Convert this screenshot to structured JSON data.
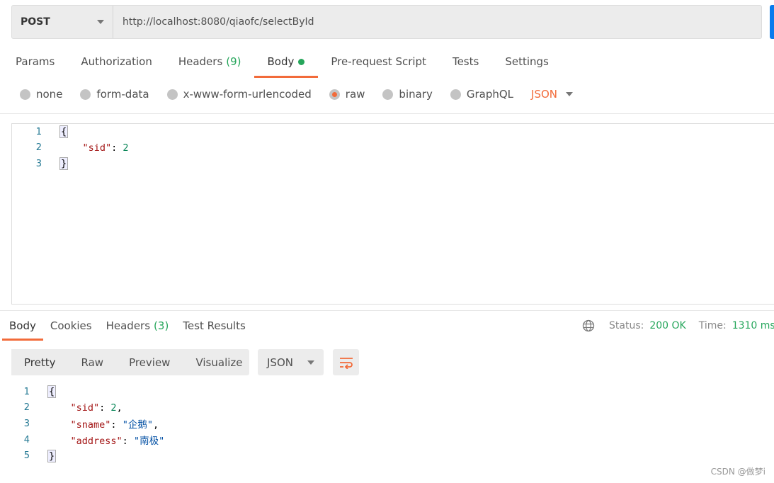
{
  "request": {
    "method": "POST",
    "url": "http://localhost:8080/qiaofc/selectById"
  },
  "tabs": [
    {
      "label": "Params"
    },
    {
      "label": "Authorization"
    },
    {
      "label": "Headers",
      "count": "(9)"
    },
    {
      "label": "Body",
      "active": true
    },
    {
      "label": "Pre-request Script"
    },
    {
      "label": "Tests"
    },
    {
      "label": "Settings"
    }
  ],
  "body_types": [
    {
      "label": "none"
    },
    {
      "label": "form-data"
    },
    {
      "label": "x-www-form-urlencoded"
    },
    {
      "label": "raw",
      "selected": true
    },
    {
      "label": "binary"
    },
    {
      "label": "GraphQL"
    }
  ],
  "body_format": "JSON",
  "request_body": [
    [
      "1",
      "{"
    ],
    [
      "2",
      "    \"sid\": 2"
    ],
    [
      "3",
      "}"
    ]
  ],
  "response": {
    "tabs": [
      {
        "label": "Body",
        "active": true
      },
      {
        "label": "Cookies"
      },
      {
        "label": "Headers",
        "count": "(3)"
      },
      {
        "label": "Test Results"
      }
    ],
    "status_label": "Status:",
    "status": "200 OK",
    "time_label": "Time:",
    "time": "1310 ms",
    "view_modes": [
      "Pretty",
      "Raw",
      "Preview",
      "Visualize"
    ],
    "active_view": "Pretty",
    "format": "JSON",
    "lines": [
      [
        "1",
        "{"
      ],
      [
        "2",
        "    \"sid\": 2,"
      ],
      [
        "3",
        "    \"sname\": \"企鹅\","
      ],
      [
        "4",
        "    \"address\": \"南极\""
      ],
      [
        "5",
        "}"
      ]
    ]
  },
  "watermark": "CSDN @做梦i",
  "colors": {
    "accent": "#f26b3a",
    "success": "#26a65b",
    "send": "#097bed"
  }
}
